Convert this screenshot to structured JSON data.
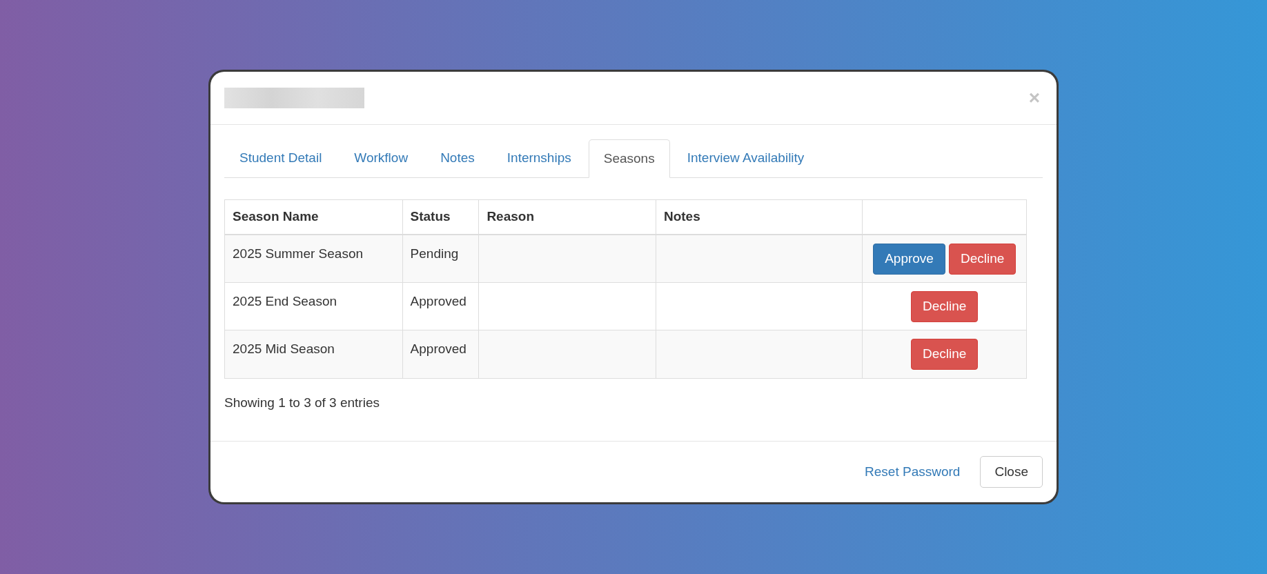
{
  "modal": {
    "close_icon": "×"
  },
  "tabs": [
    {
      "label": "Student Detail",
      "selected": false
    },
    {
      "label": "Workflow",
      "selected": false
    },
    {
      "label": "Notes",
      "selected": false
    },
    {
      "label": "Internships",
      "selected": false
    },
    {
      "label": "Seasons",
      "selected": true
    },
    {
      "label": "Interview Availability",
      "selected": false
    }
  ],
  "table": {
    "columns": [
      "Season Name",
      "Status",
      "Reason",
      "Notes"
    ],
    "rows": [
      {
        "season_name": "2025 Summer Season",
        "status": "Pending",
        "actions": [
          {
            "label": "Approve",
            "kind": "primary"
          },
          {
            "label": "Decline",
            "kind": "danger"
          }
        ]
      },
      {
        "season_name": "2025 End Season",
        "status": "Approved",
        "actions": [
          {
            "label": "Decline",
            "kind": "danger"
          }
        ]
      },
      {
        "season_name": "2025 Mid Season",
        "status": "Approved",
        "actions": [
          {
            "label": "Decline",
            "kind": "danger"
          }
        ]
      }
    ],
    "info": "Showing 1 to 3 of 3 entries"
  },
  "footer": {
    "link": "Reset Password",
    "button": "Close"
  }
}
